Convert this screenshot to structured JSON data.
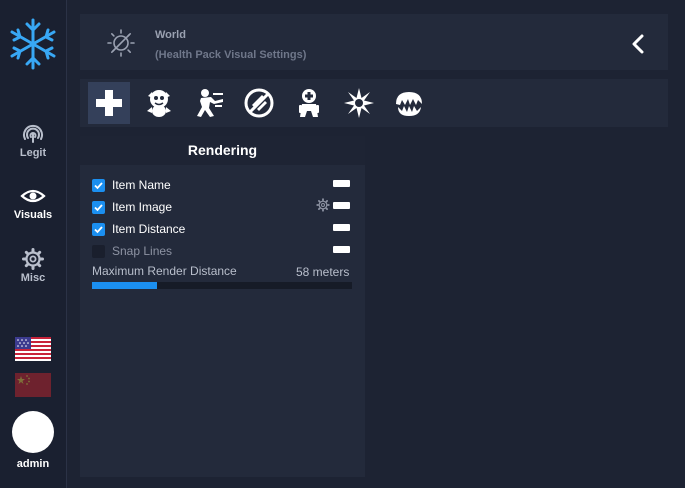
{
  "colors": {
    "accent": "#1b8ff0",
    "background": "#1d2333",
    "panel": "#232a3b",
    "sidebar": "#1a2030"
  },
  "sidebar": {
    "logo_icon": "snowflake-icon",
    "items": [
      {
        "label": "Legit",
        "icon": "fingerprint-icon",
        "active": false
      },
      {
        "label": "Visuals",
        "icon": "eye-icon",
        "active": true
      },
      {
        "label": "Misc",
        "icon": "gear-icon",
        "active": false
      }
    ],
    "languages": [
      {
        "icon": "us-flag-icon",
        "active": true
      },
      {
        "icon": "china-flag-icon",
        "active": false
      }
    ],
    "user": {
      "name": "admin"
    }
  },
  "header": {
    "icon": "world-settings-icon",
    "title": "World",
    "subtitle": "(Health Pack Visual Settings)",
    "back_icon": "chevron-left-icon"
  },
  "tabs": [
    {
      "icon": "health-pack-icon",
      "active": true
    },
    {
      "icon": "creature-icon",
      "active": false
    },
    {
      "icon": "soldier-icon",
      "active": false
    },
    {
      "icon": "no-weapon-icon",
      "active": false
    },
    {
      "icon": "medic-robot-icon",
      "active": false
    },
    {
      "icon": "burst-icon",
      "active": false
    },
    {
      "icon": "jaw-trap-icon",
      "active": false
    }
  ],
  "panel": {
    "title": "Rendering",
    "options": [
      {
        "label": "Item Name",
        "checked": true,
        "color": "#ffffff",
        "has_settings": false
      },
      {
        "label": "Item Image",
        "checked": true,
        "color": "#ffffff",
        "has_settings": true
      },
      {
        "label": "Item Distance",
        "checked": true,
        "color": "#ffffff",
        "has_settings": false
      },
      {
        "label": "Snap Lines",
        "checked": false,
        "color": "#ffffff",
        "has_settings": false
      }
    ],
    "slider": {
      "label": "Maximum Render Distance",
      "value_text": "58 meters",
      "fraction": 0.25
    }
  }
}
